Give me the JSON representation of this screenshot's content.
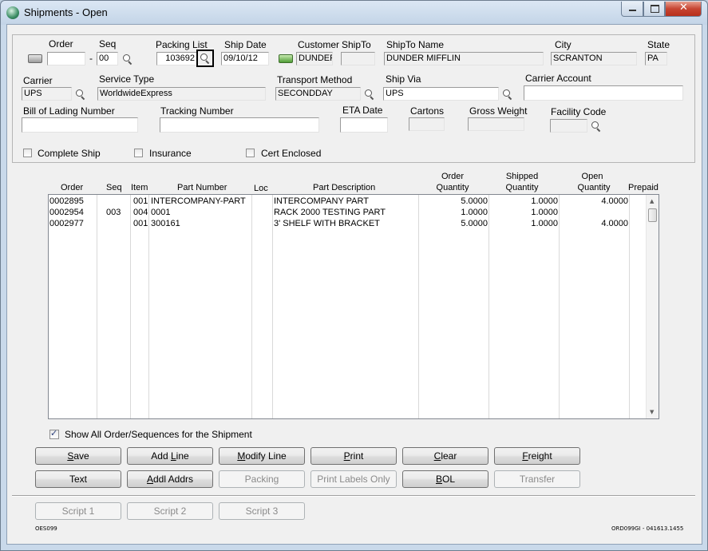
{
  "window": {
    "title": "Shipments - Open"
  },
  "header": {
    "order": {
      "label": "Order",
      "value": ""
    },
    "seq": {
      "label": "Seq",
      "dash": "-",
      "value": "00"
    },
    "packing_list": {
      "label": "Packing List",
      "value": "103692"
    },
    "ship_date": {
      "label": "Ship Date",
      "value": "09/10/12"
    },
    "customer": {
      "label": "Customer",
      "value": "DUNDER"
    },
    "shipto": {
      "label": "ShipTo",
      "value": ""
    },
    "shipto_name": {
      "label": "ShipTo Name",
      "value": "DUNDER MIFFLIN"
    },
    "city": {
      "label": "City",
      "value": "SCRANTON"
    },
    "state": {
      "label": "State",
      "value": "PA"
    },
    "carrier": {
      "label": "Carrier",
      "value": "UPS"
    },
    "service_type": {
      "label": "Service Type",
      "value": "WorldwideExpress"
    },
    "transport_method": {
      "label": "Transport Method",
      "value": "SECONDDAY"
    },
    "ship_via": {
      "label": "Ship Via",
      "value": "UPS"
    },
    "carrier_account": {
      "label": "Carrier Account",
      "value": ""
    },
    "bol_number": {
      "label": "Bill of Lading Number",
      "value": ""
    },
    "tracking_number": {
      "label": "Tracking Number",
      "value": ""
    },
    "eta_date": {
      "label": "ETA Date",
      "value": ""
    },
    "cartons": {
      "label": "Cartons",
      "value": ""
    },
    "gross_weight": {
      "label": "Gross Weight",
      "value": ""
    },
    "facility_code": {
      "label": "Facility Code",
      "value": ""
    },
    "complete_ship": {
      "label": "Complete Ship",
      "checked": false
    },
    "insurance": {
      "label": "Insurance",
      "checked": false
    },
    "cert_enclosed": {
      "label": "Cert Enclosed",
      "checked": false
    }
  },
  "grid": {
    "columns": {
      "order": "Order",
      "seq": "Seq",
      "item": "Item",
      "part_number": "Part Number",
      "loc": "Loc",
      "part_description": "Part Description",
      "order_qty_1": "Order",
      "order_qty_2": "Quantity",
      "shipped_qty_1": "Shipped",
      "shipped_qty_2": "Quantity",
      "open_qty_1": "Open",
      "open_qty_2": "Quantity",
      "prepaid": "Prepaid"
    },
    "rows": [
      {
        "order": "0002895",
        "seq": "",
        "item": "001",
        "part_number": "INTERCOMPANY-PART",
        "loc": "",
        "description": "INTERCOMPANY PART",
        "order_qty": "5.0000",
        "shipped_qty": "1.0000",
        "open_qty": "4.0000"
      },
      {
        "order": "0002954",
        "seq": "003",
        "item": "004",
        "part_number": "0001",
        "loc": "",
        "description": "RACK 2000 TESTING PART",
        "order_qty": "1.0000",
        "shipped_qty": "1.0000",
        "open_qty": ""
      },
      {
        "order": "0002977",
        "seq": "",
        "item": "001",
        "part_number": "300161",
        "loc": "",
        "description": "3' SHELF WITH BRACKET",
        "order_qty": "5.0000",
        "shipped_qty": "1.0000",
        "open_qty": "4.0000"
      }
    ]
  },
  "show_all": {
    "label": "Show All Order/Sequences for the Shipment",
    "checked": true
  },
  "buttons": {
    "save": {
      "pre": "",
      "key": "S",
      "post": "ave"
    },
    "add_line": {
      "pre": "Add ",
      "key": "L",
      "post": "ine"
    },
    "modify_line": {
      "pre": "",
      "key": "M",
      "post": "odify Line"
    },
    "print": {
      "pre": "",
      "key": "P",
      "post": "rint"
    },
    "clear": {
      "pre": "",
      "key": "C",
      "post": "lear"
    },
    "freight": {
      "pre": "",
      "key": "F",
      "post": "reight"
    },
    "text": {
      "pre": "",
      "key": "",
      "post": "Text"
    },
    "addl_addrs": {
      "pre": "",
      "key": "A",
      "post": "ddl Addrs"
    },
    "packing": {
      "pre": "",
      "key": "",
      "post": "Packing"
    },
    "print_labels_only": {
      "pre": "",
      "key": "",
      "post": "Print Labels Only"
    },
    "bol": {
      "pre": "",
      "key": "B",
      "post": "OL"
    },
    "transfer": {
      "pre": "",
      "key": "",
      "post": "Transfer"
    },
    "script1": "Script 1",
    "script2": "Script 2",
    "script3": "Script 3"
  },
  "footer": {
    "left_code": "OES099",
    "right_code": "ORD099GI - 041613.1455"
  },
  "colors": {
    "titlebar": "#c9d9ea",
    "client_bg": "#f0f0f0",
    "close_button": "#c74532",
    "link_green": "#4f9d36"
  }
}
